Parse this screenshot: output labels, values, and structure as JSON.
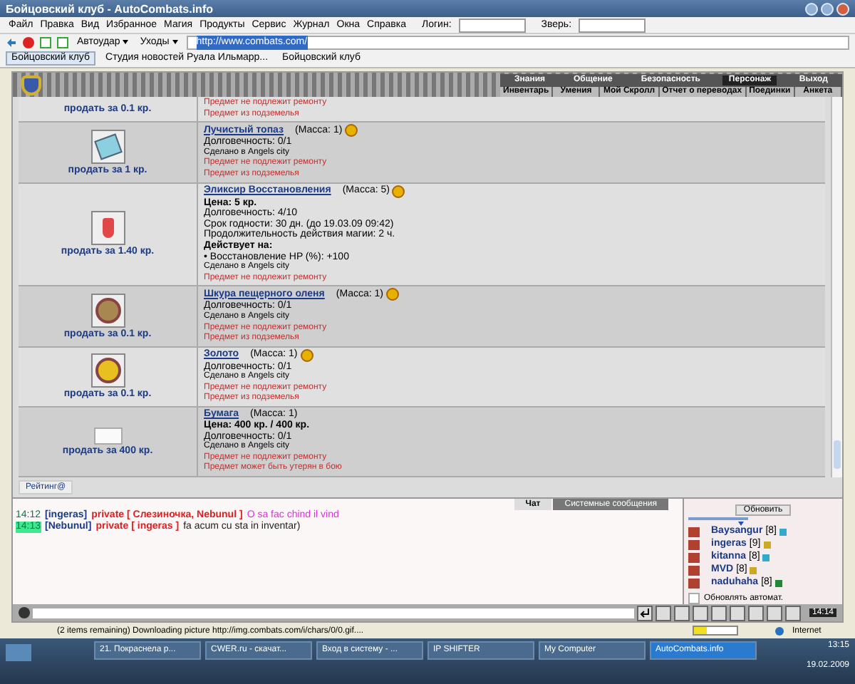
{
  "window": {
    "title": "Бойцовский клуб - AutoCombats.info"
  },
  "menu": [
    "Файл",
    "Правка",
    "Вид",
    "Избранное",
    "Магия",
    "Продукты",
    "Сервис",
    "Журнал",
    "Окна",
    "Справка"
  ],
  "login": {
    "label": "Логин:",
    "beast_label": "Зверь:"
  },
  "toolbar": {
    "autohit": "Автоудар",
    "leaves": "Уходы",
    "address": "http://www.combats.com/"
  },
  "tabs": [
    {
      "label": "Бойцовский клуб",
      "selected": true
    },
    {
      "label": "Студия новостей Руала Ильмарр...",
      "selected": false
    },
    {
      "label": "Бойцовский клуб",
      "selected": false
    }
  ],
  "game_nav": {
    "top": [
      {
        "label": "Знания",
        "selected": false
      },
      {
        "label": "Общение",
        "selected": false
      },
      {
        "label": "Безопасность",
        "selected": false
      },
      {
        "label": "Персонаж",
        "selected": true
      },
      {
        "label": "Выход",
        "selected": false
      }
    ],
    "bottom": [
      "Инвентарь",
      "Умения",
      "Мой Скролл",
      "Отчет о переводах",
      "Поединки",
      "Анкета"
    ]
  },
  "items": [
    {
      "kind": "none",
      "sell": "продать за 0.1 кр.",
      "lines": [
        {
          "kind": "warn",
          "text": "Предмет не подлежит ремонту"
        },
        {
          "kind": "warn",
          "text": "Предмет из подземелья"
        }
      ]
    },
    {
      "kind": "gem",
      "sell": "продать за 1 кр.",
      "name": "Лучистый топаз",
      "mass": "(Масса: 1)",
      "lines": [
        {
          "kind": "text",
          "text": "Долговечность: 0/1"
        },
        {
          "kind": "small",
          "text": "Сделано в Angels city"
        },
        {
          "kind": "warn",
          "text": "Предмет не подлежит ремонту"
        },
        {
          "kind": "warn",
          "text": "Предмет из подземелья"
        }
      ]
    },
    {
      "kind": "potion",
      "sell": "продать за 1.40 кр.",
      "name": "Эликсир Восстановления",
      "mass": "(Масса: 5)",
      "lines": [
        {
          "kind": "bold",
          "text": "Цена: 5 кр."
        },
        {
          "kind": "text",
          "text": "Долговечность: 4/10"
        },
        {
          "kind": "text",
          "text": "Срок годности: 30 дн. (до 19.03.09 09:42)"
        },
        {
          "kind": "text",
          "text": "Продолжительность действия магии: 2 ч."
        },
        {
          "kind": "bold",
          "text": "Действует на:"
        },
        {
          "kind": "text",
          "text": "• Восстановление HP (%): +100"
        },
        {
          "kind": "small",
          "text": "Сделано в Angels city"
        },
        {
          "kind": "warn",
          "text": "Предмет не подлежит ремонту"
        }
      ]
    },
    {
      "kind": "hide",
      "sell": "продать за 0.1 кр.",
      "name": "Шкура пещерного оленя",
      "mass": "(Масса: 1)",
      "lines": [
        {
          "kind": "text",
          "text": "Долговечность: 0/1"
        },
        {
          "kind": "small",
          "text": "Сделано в Angels city"
        },
        {
          "kind": "warn",
          "text": "Предмет не подлежит ремонту"
        },
        {
          "kind": "warn",
          "text": "Предмет из подземелья"
        }
      ]
    },
    {
      "kind": "gold",
      "sell": "продать за 0.1 кр.",
      "name": "Золото",
      "mass": "(Масса: 1)",
      "lines": [
        {
          "kind": "text",
          "text": "Долговечность: 0/1"
        },
        {
          "kind": "small",
          "text": "Сделано в Angels city"
        },
        {
          "kind": "warn",
          "text": "Предмет не подлежит ремонту"
        },
        {
          "kind": "warn",
          "text": "Предмет из подземелья"
        }
      ]
    },
    {
      "kind": "paper",
      "sell": "продать за 400 кр.",
      "name": "Бумага",
      "mass": "(Масса: 1)",
      "lines": [
        {
          "kind": "bold",
          "text": "Цена: 400 кр. / 400 кр."
        },
        {
          "kind": "text",
          "text": "Долговечность: 0/1"
        },
        {
          "kind": "small",
          "text": "Сделано в Angels city"
        },
        {
          "kind": "warn",
          "text": "Предмет не подлежит ремонту"
        },
        {
          "kind": "warn",
          "text": "Предмет может быть утерян в бою"
        }
      ]
    }
  ],
  "rating": "Рейтинг@",
  "chat": {
    "tabs": [
      {
        "label": "Чат",
        "selected": true
      },
      {
        "label": "Системные сообщения",
        "selected": false
      }
    ],
    "messages": [
      {
        "time": "14:12",
        "highlight": false,
        "nick": "[ingeras]",
        "private": "private [ Слезиночка, Nebunul ]",
        "text": "O sa fac chind il vind",
        "color": "#e030e0"
      },
      {
        "time": "14:13",
        "highlight": true,
        "nick": "[Nebunul]",
        "private": "private [ ingeras ]",
        "text": "fa acum cu sta in inventar)",
        "color": "#202020"
      }
    ]
  },
  "online": {
    "refresh": "Обновить",
    "users": [
      {
        "name": "Baysangur",
        "level": "[8]",
        "color": "#33aacc"
      },
      {
        "name": "ingeras",
        "level": "[9]",
        "color": "#ccaa22"
      },
      {
        "name": "kitanna",
        "level": "[8]",
        "color": "#33aacc"
      },
      {
        "name": "MVD",
        "level": "[8]",
        "color": "#ccaa22"
      },
      {
        "name": "naduhaha",
        "level": "[8]",
        "color": "#228833"
      }
    ],
    "auto": {
      "label": "Обновлять автомат.",
      "checked": false
    }
  },
  "game_clock": "14:14",
  "status_bar": {
    "text": "(2 items remaining) Downloading picture http://img.combats.com/i/chars/0/0.gif....",
    "level": 0.3,
    "zone": "Internet"
  },
  "taskbar": {
    "items": [
      {
        "label": "21. Покраснела р...",
        "selected": false
      },
      {
        "label": "CWER.ru - скачат...",
        "selected": false
      },
      {
        "label": "Вход в систему - ...",
        "selected": false
      },
      {
        "label": "IP SHIFTER",
        "selected": false
      },
      {
        "label": "My Computer",
        "selected": false
      },
      {
        "label": "AutoCombats.info",
        "selected": true
      }
    ],
    "time": "13:15",
    "date": "19.02.2009"
  }
}
